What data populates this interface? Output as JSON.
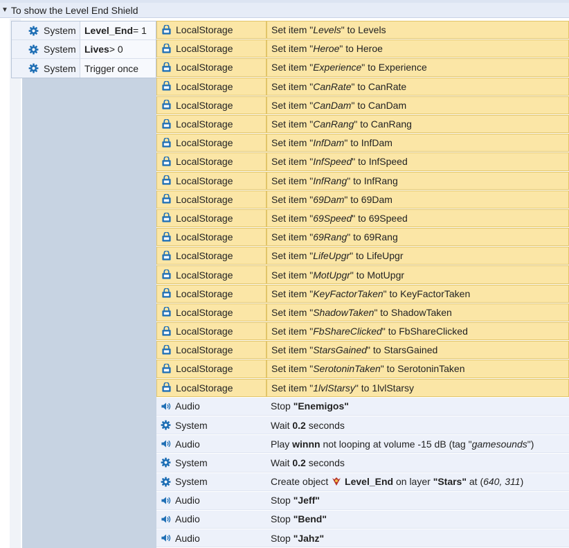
{
  "group": {
    "title": "To show the Level End Shield"
  },
  "conditions": [
    {
      "object": "System",
      "icon": "gear-icon",
      "parts": [
        {
          "t": "Level_End",
          "s": "b"
        },
        {
          "t": " = 1",
          "s": ""
        }
      ]
    },
    {
      "object": "System",
      "icon": "gear-icon",
      "parts": [
        {
          "t": "Lives",
          "s": "b"
        },
        {
          "t": " > 0",
          "s": ""
        }
      ]
    },
    {
      "object": "System",
      "icon": "gear-icon",
      "parts": [
        {
          "t": "Trigger once",
          "s": ""
        }
      ]
    }
  ],
  "actions": [
    {
      "object": "LocalStorage",
      "icon": "localstorage-icon",
      "kind": "ls",
      "parts": [
        {
          "t": "Set item \"",
          "s": ""
        },
        {
          "t": "Levels",
          "s": "i"
        },
        {
          "t": "\" to Levels",
          "s": ""
        }
      ]
    },
    {
      "object": "LocalStorage",
      "icon": "localstorage-icon",
      "kind": "ls",
      "parts": [
        {
          "t": "Set item \"",
          "s": ""
        },
        {
          "t": "Heroe",
          "s": "i"
        },
        {
          "t": "\" to Heroe",
          "s": ""
        }
      ]
    },
    {
      "object": "LocalStorage",
      "icon": "localstorage-icon",
      "kind": "ls",
      "parts": [
        {
          "t": "Set item \"",
          "s": ""
        },
        {
          "t": "Experience",
          "s": "i"
        },
        {
          "t": "\" to Experience",
          "s": ""
        }
      ]
    },
    {
      "object": "LocalStorage",
      "icon": "localstorage-icon",
      "kind": "ls",
      "parts": [
        {
          "t": "Set item \"",
          "s": ""
        },
        {
          "t": "CanRate",
          "s": "i"
        },
        {
          "t": "\" to CanRate",
          "s": ""
        }
      ]
    },
    {
      "object": "LocalStorage",
      "icon": "localstorage-icon",
      "kind": "ls",
      "parts": [
        {
          "t": "Set item \"",
          "s": ""
        },
        {
          "t": "CanDam",
          "s": "i"
        },
        {
          "t": "\" to CanDam",
          "s": ""
        }
      ]
    },
    {
      "object": "LocalStorage",
      "icon": "localstorage-icon",
      "kind": "ls",
      "parts": [
        {
          "t": "Set item \"",
          "s": ""
        },
        {
          "t": "CanRang",
          "s": "i"
        },
        {
          "t": "\" to CanRang",
          "s": ""
        }
      ]
    },
    {
      "object": "LocalStorage",
      "icon": "localstorage-icon",
      "kind": "ls",
      "parts": [
        {
          "t": "Set item \"",
          "s": ""
        },
        {
          "t": "InfDam",
          "s": "i"
        },
        {
          "t": "\" to InfDam",
          "s": ""
        }
      ]
    },
    {
      "object": "LocalStorage",
      "icon": "localstorage-icon",
      "kind": "ls",
      "parts": [
        {
          "t": "Set item \"",
          "s": ""
        },
        {
          "t": "InfSpeed",
          "s": "i"
        },
        {
          "t": "\" to InfSpeed",
          "s": ""
        }
      ]
    },
    {
      "object": "LocalStorage",
      "icon": "localstorage-icon",
      "kind": "ls",
      "parts": [
        {
          "t": "Set item \"",
          "s": ""
        },
        {
          "t": "InfRang",
          "s": "i"
        },
        {
          "t": "\" to InfRang",
          "s": ""
        }
      ]
    },
    {
      "object": "LocalStorage",
      "icon": "localstorage-icon",
      "kind": "ls",
      "parts": [
        {
          "t": "Set item \"",
          "s": ""
        },
        {
          "t": "69Dam",
          "s": "i"
        },
        {
          "t": "\" to 69Dam",
          "s": ""
        }
      ]
    },
    {
      "object": "LocalStorage",
      "icon": "localstorage-icon",
      "kind": "ls",
      "parts": [
        {
          "t": "Set item \"",
          "s": ""
        },
        {
          "t": "69Speed",
          "s": "i"
        },
        {
          "t": "\" to 69Speed",
          "s": ""
        }
      ]
    },
    {
      "object": "LocalStorage",
      "icon": "localstorage-icon",
      "kind": "ls",
      "parts": [
        {
          "t": "Set item \"",
          "s": ""
        },
        {
          "t": "69Rang",
          "s": "i"
        },
        {
          "t": "\" to 69Rang",
          "s": ""
        }
      ]
    },
    {
      "object": "LocalStorage",
      "icon": "localstorage-icon",
      "kind": "ls",
      "parts": [
        {
          "t": "Set item \"",
          "s": ""
        },
        {
          "t": "LifeUpgr",
          "s": "i"
        },
        {
          "t": "\" to LifeUpgr",
          "s": ""
        }
      ]
    },
    {
      "object": "LocalStorage",
      "icon": "localstorage-icon",
      "kind": "ls",
      "parts": [
        {
          "t": "Set item \"",
          "s": ""
        },
        {
          "t": "MotUpgr",
          "s": "i"
        },
        {
          "t": "\" to MotUpgr",
          "s": ""
        }
      ]
    },
    {
      "object": "LocalStorage",
      "icon": "localstorage-icon",
      "kind": "ls",
      "parts": [
        {
          "t": "Set item \"",
          "s": ""
        },
        {
          "t": "KeyFactorTaken",
          "s": "i"
        },
        {
          "t": "\" to KeyFactorTaken",
          "s": ""
        }
      ]
    },
    {
      "object": "LocalStorage",
      "icon": "localstorage-icon",
      "kind": "ls",
      "parts": [
        {
          "t": "Set item \"",
          "s": ""
        },
        {
          "t": "ShadowTaken",
          "s": "i"
        },
        {
          "t": "\" to ShadowTaken",
          "s": ""
        }
      ]
    },
    {
      "object": "LocalStorage",
      "icon": "localstorage-icon",
      "kind": "ls",
      "parts": [
        {
          "t": "Set item \"",
          "s": ""
        },
        {
          "t": "FbShareClicked",
          "s": "i"
        },
        {
          "t": "\" to FbShareClicked",
          "s": ""
        }
      ]
    },
    {
      "object": "LocalStorage",
      "icon": "localstorage-icon",
      "kind": "ls",
      "parts": [
        {
          "t": "Set item \"",
          "s": ""
        },
        {
          "t": "StarsGained",
          "s": "i"
        },
        {
          "t": "\" to StarsGained",
          "s": ""
        }
      ]
    },
    {
      "object": "LocalStorage",
      "icon": "localstorage-icon",
      "kind": "ls",
      "parts": [
        {
          "t": "Set item \"",
          "s": ""
        },
        {
          "t": "SerotoninTaken",
          "s": "i"
        },
        {
          "t": "\" to SerotoninTaken",
          "s": ""
        }
      ]
    },
    {
      "object": "LocalStorage",
      "icon": "localstorage-icon",
      "kind": "ls",
      "parts": [
        {
          "t": "Set item \"",
          "s": ""
        },
        {
          "t": "1lvlStarsy",
          "s": "i"
        },
        {
          "t": "\" to 1lvlStarsy",
          "s": ""
        }
      ]
    },
    {
      "object": "Audio",
      "icon": "speaker-icon",
      "kind": "plain",
      "parts": [
        {
          "t": "Stop ",
          "s": ""
        },
        {
          "t": "\"Enemigos\"",
          "s": "b"
        }
      ]
    },
    {
      "object": "System",
      "icon": "gear-icon",
      "kind": "plain",
      "parts": [
        {
          "t": "Wait ",
          "s": ""
        },
        {
          "t": "0.2",
          "s": "b"
        },
        {
          "t": " seconds",
          "s": ""
        }
      ]
    },
    {
      "object": "Audio",
      "icon": "speaker-icon",
      "kind": "plain",
      "parts": [
        {
          "t": "Play ",
          "s": ""
        },
        {
          "t": "winnn",
          "s": "b"
        },
        {
          "t": " not looping at volume -15 dB (tag \"",
          "s": ""
        },
        {
          "t": "gamesounds",
          "s": "i"
        },
        {
          "t": "\")",
          "s": ""
        }
      ]
    },
    {
      "object": "System",
      "icon": "gear-icon",
      "kind": "plain",
      "parts": [
        {
          "t": "Wait ",
          "s": ""
        },
        {
          "t": "0.2",
          "s": "b"
        },
        {
          "t": " seconds",
          "s": ""
        }
      ]
    },
    {
      "object": "System",
      "icon": "gear-icon",
      "kind": "plain",
      "parts": [
        {
          "t": "Create object ",
          "s": ""
        },
        {
          "t": "",
          "s": "sprite"
        },
        {
          "t": " Level_End",
          "s": "b"
        },
        {
          "t": " on layer ",
          "s": ""
        },
        {
          "t": "\"Stars\"",
          "s": "b"
        },
        {
          "t": " at (",
          "s": ""
        },
        {
          "t": "640, 311",
          "s": "i"
        },
        {
          "t": ")",
          "s": ""
        }
      ]
    },
    {
      "object": "Audio",
      "icon": "speaker-icon",
      "kind": "plain",
      "parts": [
        {
          "t": "Stop ",
          "s": ""
        },
        {
          "t": "\"Jeff\"",
          "s": "b"
        }
      ]
    },
    {
      "object": "Audio",
      "icon": "speaker-icon",
      "kind": "plain",
      "parts": [
        {
          "t": "Stop ",
          "s": ""
        },
        {
          "t": "\"Bend\"",
          "s": "b"
        }
      ]
    },
    {
      "object": "Audio",
      "icon": "speaker-icon",
      "kind": "plain",
      "parts": [
        {
          "t": "Stop ",
          "s": ""
        },
        {
          "t": "\"Jahz\"",
          "s": "b"
        }
      ]
    }
  ],
  "colors": {
    "localstorage_row": "#fbe6a6",
    "plain_row": "#edf1fa",
    "left_pane": "#c7d3e2",
    "accent_icon": "#1f6fb5"
  }
}
